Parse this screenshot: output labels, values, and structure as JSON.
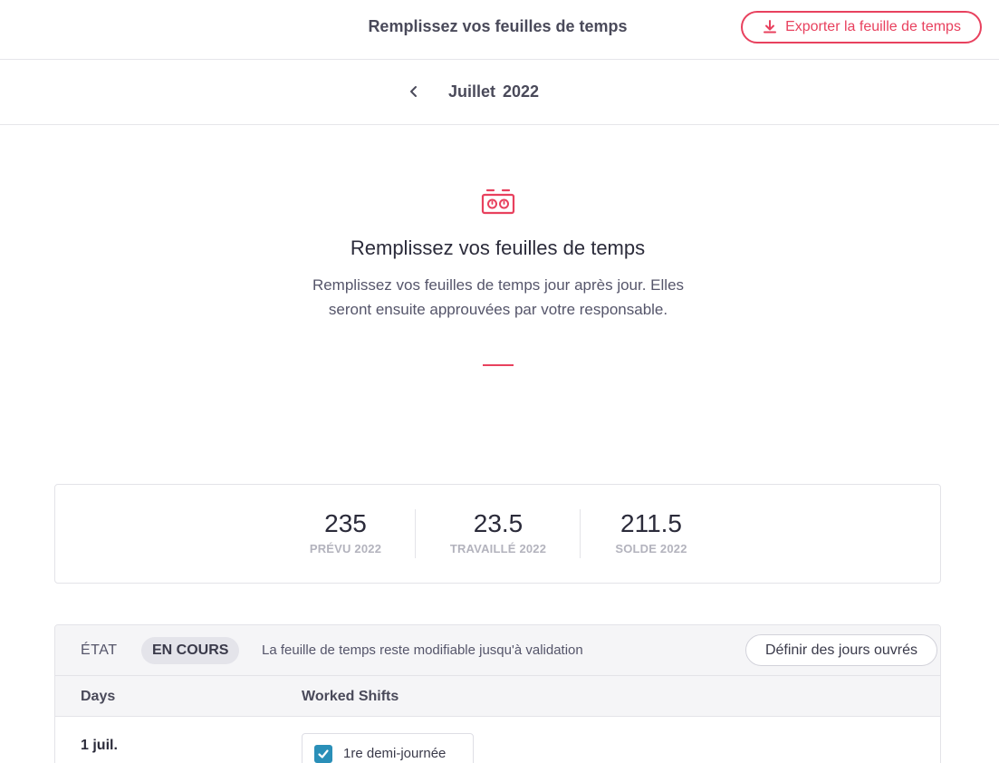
{
  "header": {
    "title": "Remplissez vos feuilles de temps",
    "export_label": "Exporter la feuille de temps"
  },
  "period": {
    "month": "Juillet",
    "year": "2022"
  },
  "intro": {
    "title": "Remplissez vos feuilles de temps",
    "description": "Remplissez vos feuilles de temps jour après jour. Elles seront ensuite approuvées par votre responsable."
  },
  "stats": [
    {
      "value": "235",
      "label": "PRÉVU 2022"
    },
    {
      "value": "23.5",
      "label": "TRAVAILLÉ 2022"
    },
    {
      "value": "211.5",
      "label": "SOLDE 2022"
    }
  ],
  "timesheet": {
    "state_label": "ÉTAT",
    "status": "EN COURS",
    "status_note": "La feuille de temps reste modifiable jusqu'à validation",
    "define_days_label": "Définir des jours ouvrés",
    "columns": {
      "days": "Days",
      "shifts": "Worked Shifts"
    },
    "rows": [
      {
        "date": "1 juil.",
        "shift_label": "1re demi-journée",
        "checked": true
      }
    ]
  },
  "colors": {
    "accent": "#e8415e",
    "checkbox": "#2a8fb8"
  }
}
